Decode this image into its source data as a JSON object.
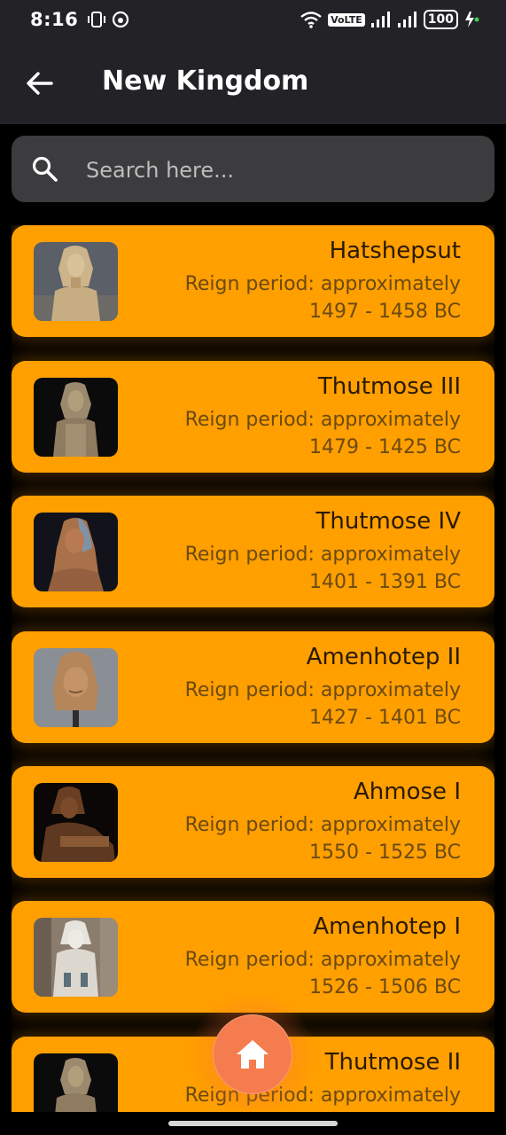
{
  "status_bar": {
    "time": "8:16",
    "network_label": "VoLTE",
    "battery": "100",
    "icons": [
      "vibrate-icon",
      "notification-app-icon",
      "wifi-icon",
      "volte-icon",
      "signal-icon",
      "signal-icon",
      "battery-icon",
      "charging-icon"
    ]
  },
  "header": {
    "title": "New Kingdom"
  },
  "search": {
    "placeholder": "Search here..."
  },
  "kings": [
    {
      "name": "Hatshepsut",
      "reign_label": "Reign period: approximately",
      "years": "1497 - 1458 BC"
    },
    {
      "name": "Thutmose III",
      "reign_label": "Reign period: approximately",
      "years": "1479 - 1425 BC"
    },
    {
      "name": "Thutmose IV",
      "reign_label": "Reign period: approximately",
      "years": "1401 - 1391 BC"
    },
    {
      "name": "Amenhotep II",
      "reign_label": "Reign period: approximately",
      "years": "1427 - 1401 BC"
    },
    {
      "name": "Ahmose I",
      "reign_label": "Reign period: approximately",
      "years": "1550 - 1525 BC"
    },
    {
      "name": "Amenhotep I",
      "reign_label": "Reign period: approximately",
      "years": "1526 - 1506 BC"
    },
    {
      "name": "Thutmose II",
      "reign_label": "Reign period: approximately",
      "years": ""
    }
  ],
  "colors": {
    "card": "#ff9f00",
    "appbar": "#232327",
    "home_button": "#f57c4e",
    "search_bg": "#3c3c3e"
  }
}
